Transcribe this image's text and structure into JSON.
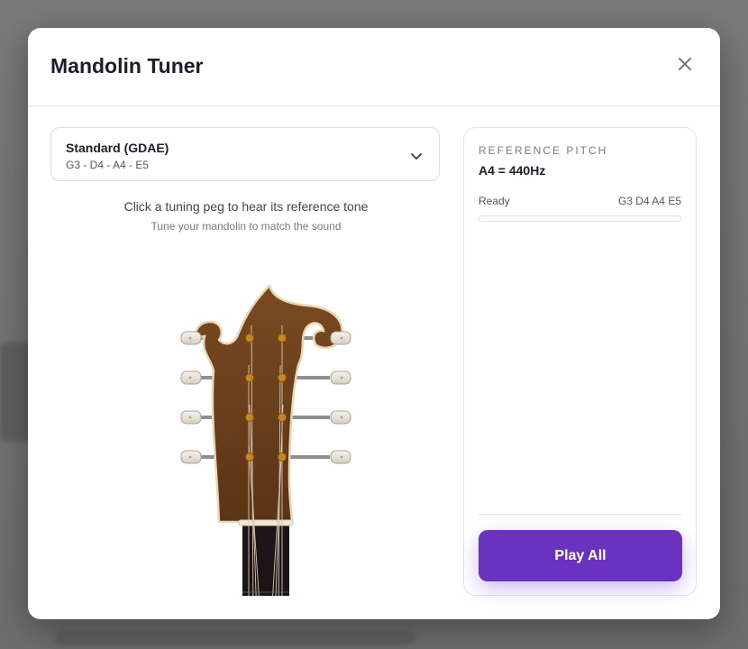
{
  "modal": {
    "title": "Mandolin Tuner"
  },
  "tuning_select": {
    "name": "Standard (GDAE)",
    "notes": "G3 - D4 - A4 - E5"
  },
  "instructions": {
    "primary": "Click a tuning peg to hear its reference tone",
    "secondary": "Tune your mandolin to match the sound"
  },
  "reference": {
    "label": "REFERENCE PITCH",
    "value": "A4 = 440Hz",
    "status": "Ready",
    "status_notes": "G3 D4 A4 E5",
    "progress": 0
  },
  "actions": {
    "play_all_label": "Play All"
  },
  "colors": {
    "accent": "#6a32bf",
    "headstock": "#6b3f1c",
    "binding": "#e8d7b4",
    "fretboard": "#1d1418"
  },
  "icons": {
    "close": "close-icon",
    "dropdown": "chevron-down-icon"
  }
}
